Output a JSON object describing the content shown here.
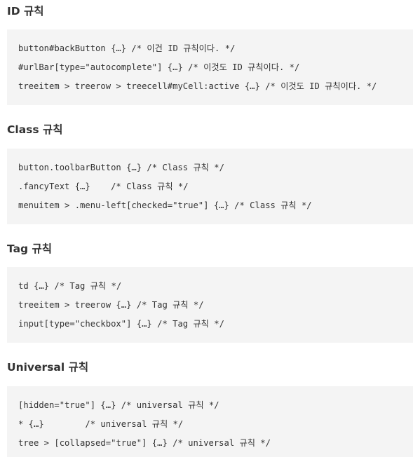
{
  "sections": [
    {
      "heading": "ID 규칙",
      "lines": [
        "button#backButton {…} /* 이건 ID 규칙이다. */",
        "#urlBar[type=\"autocomplete\"] {…} /* 이것도 ID 규칙이다. */",
        "treeitem > treerow > treecell#myCell:active {…} /* 이것도 ID 규칙이다. */"
      ]
    },
    {
      "heading": "Class 규칙",
      "lines": [
        "button.toolbarButton {…} /* Class 규칙 */",
        ".fancyText {…}    /* Class 규칙 */",
        "menuitem > .menu-left[checked=\"true\"] {…} /* Class 규칙 */"
      ]
    },
    {
      "heading": "Tag 규칙",
      "lines": [
        "td {…} /* Tag 규칙 */",
        "treeitem > treerow {…} /* Tag 규칙 */",
        "input[type=\"checkbox\"] {…} /* Tag 규칙 */"
      ]
    },
    {
      "heading": "Universal 규칙",
      "lines": [
        "[hidden=\"true\"] {…} /* universal 규칙 */",
        "* {…}        /* universal 규칙 */",
        "tree > [collapsed=\"true\"] {…} /* universal 규칙 */"
      ]
    }
  ]
}
